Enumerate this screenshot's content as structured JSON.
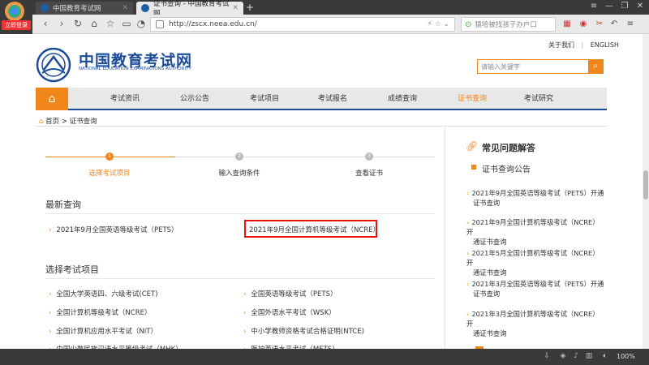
{
  "browser": {
    "tabs": [
      {
        "title": "中国教育考试网"
      },
      {
        "title": "证书查询 - 中国教育考试网"
      }
    ],
    "new_tab": "+",
    "login_badge": "立即登录",
    "url": "http://zscx.neea.edu.cn/",
    "search_placeholder": "猿哈被找孩子办户口",
    "zoom": "100%"
  },
  "site": {
    "top_links": {
      "about": "关于我们",
      "sep": "|",
      "english": "ENGLISH"
    },
    "search_placeholder": "请输入关键字",
    "brand_cn": "中国教育考试网",
    "brand_en": "NATIONAL EDUCATION EXAMINATIONS AUTHORITY",
    "menu": [
      "考试资讯",
      "公示公告",
      "考试项目",
      "考试报名",
      "成绩查询",
      "证书查询",
      "考试研究"
    ],
    "active_menu": "证书查询",
    "breadcrumb": {
      "home": "首页",
      "sep": ">",
      "current": "证书查询"
    }
  },
  "steps": [
    {
      "num": "1",
      "label": "选择考试项目",
      "active": true
    },
    {
      "num": "2",
      "label": "输入查询条件",
      "active": false
    },
    {
      "num": "3",
      "label": "查看证书",
      "active": false
    }
  ],
  "latest": {
    "title": "最新查询",
    "items": [
      "2021年9月全国英语等级考试（PETS）",
      "2021年9月全国计算机等级考试（NCRE）"
    ]
  },
  "projects": {
    "title": "选择考试项目",
    "left": [
      "全国大学英语四、六级考试(CET)",
      "全国计算机等级考试（NCRE）",
      "全国计算机应用水平考试（NIT）",
      "中国少数民族汉语水平等级考试（MHK）"
    ],
    "right": [
      "全国英语等级考试（PETS）",
      "全国外语水平考试（WSK）",
      "中小学教师资格考试合格证明(NTCE)",
      "医护英语水平考试（METS）"
    ]
  },
  "sidebar": {
    "faq_title": "常见问题解答",
    "cert_title": "证书查询公告",
    "news": [
      {
        "l1": "2021年9月全国英语等级考试（PETS）开通",
        "l2": "证书查询"
      },
      {
        "l1": "2021年9月全国计算机等级考试（NCRE）开",
        "l2": "通证书查询"
      },
      {
        "l1": "2021年5月全国计算机等级考试（NCRE）开",
        "l2": "通证书查询"
      },
      {
        "l1": "2021年3月全国英语等级考试（PETS）开通",
        "l2": "证书查询"
      },
      {
        "l1": "2021年3月全国计算机等级考试（NCRE）开",
        "l2": "通证书查询"
      }
    ]
  },
  "colors": {
    "accent": "#f08519",
    "brand": "#1c4c98",
    "highlight": "#e8120c"
  }
}
